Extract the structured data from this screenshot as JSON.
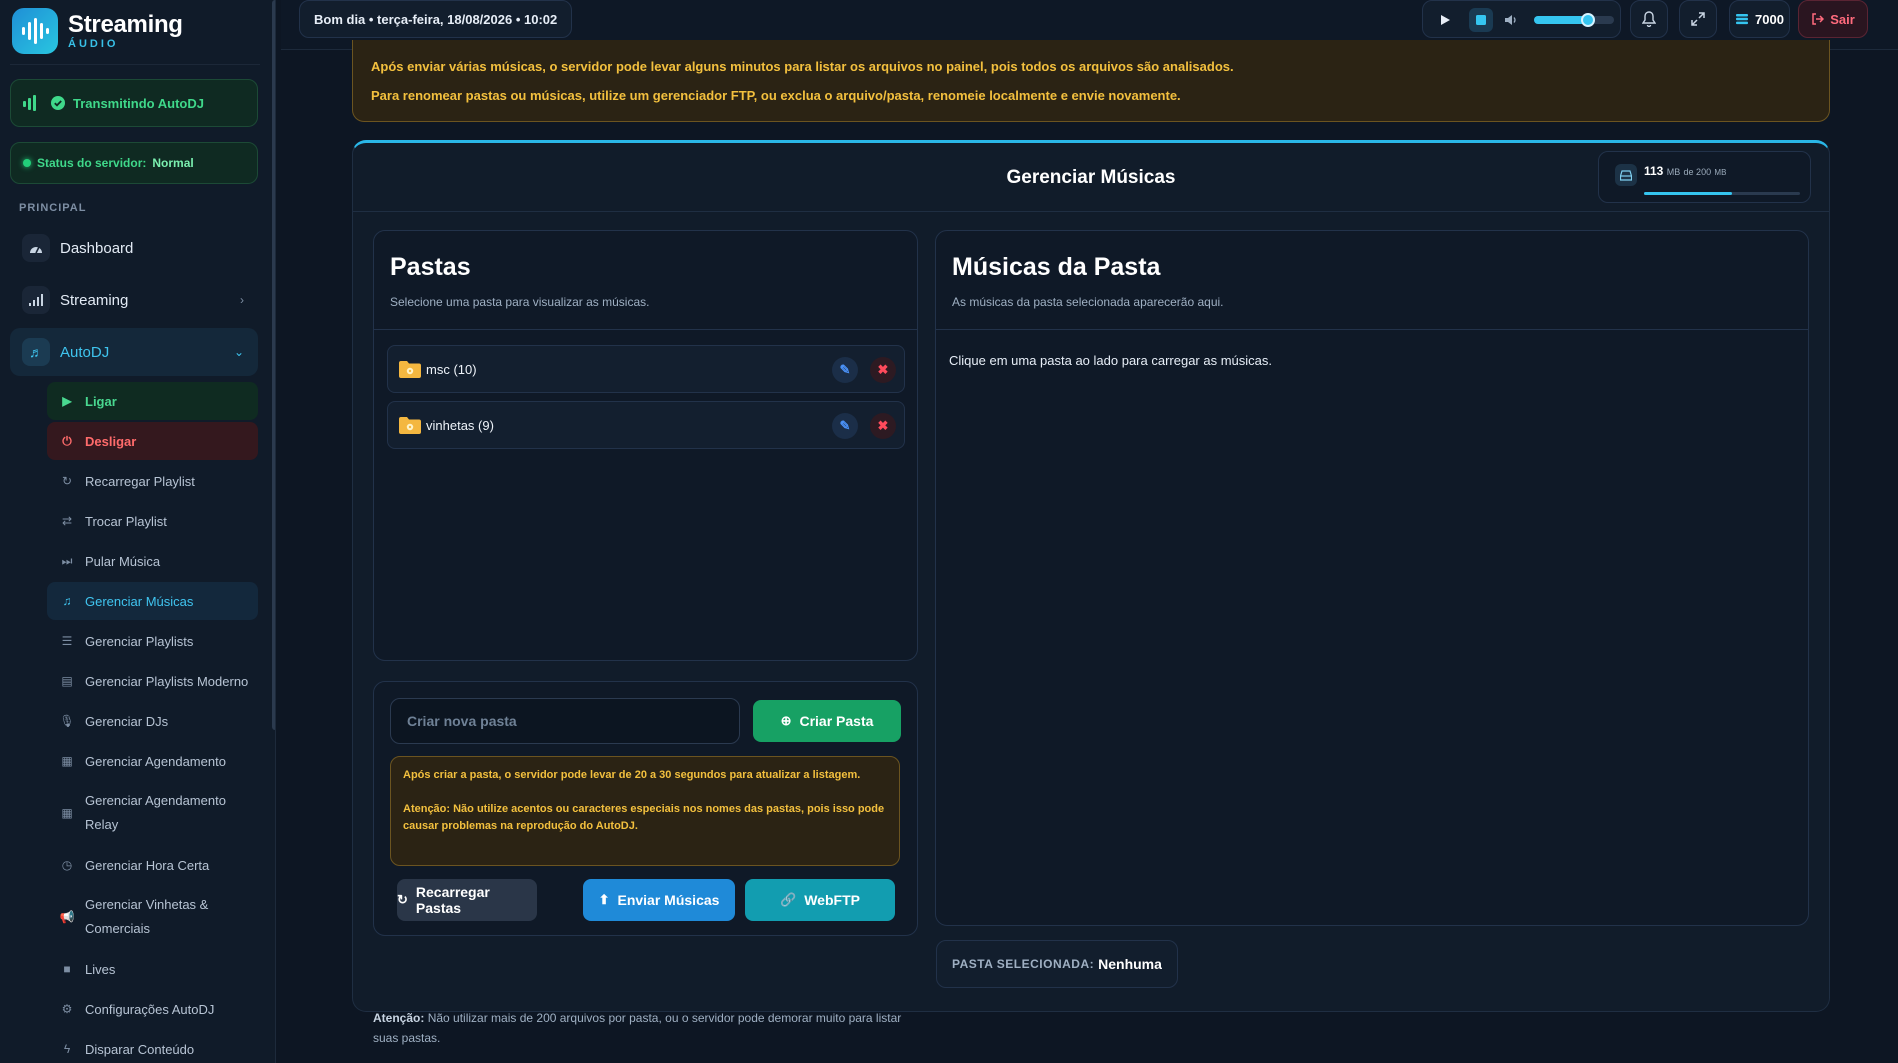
{
  "brand": {
    "title": "Streaming",
    "subtitle": "ÁUDIO"
  },
  "status": {
    "live": "Transmitindo AutoDJ",
    "server_label": "Status do servidor:",
    "server_value": "Normal"
  },
  "sidebar": {
    "section": "PRINCIPAL",
    "top": [
      {
        "label": "Dashboard",
        "icon": "gauge-icon"
      },
      {
        "label": "Streaming",
        "icon": "signal-icon"
      },
      {
        "label": "AutoDJ",
        "icon": "music-icon"
      }
    ],
    "sub": [
      {
        "label": "Ligar",
        "icon": "play-circle-icon"
      },
      {
        "label": "Desligar",
        "icon": "power-icon"
      },
      {
        "label": "Recarregar Playlist",
        "icon": "refresh-icon"
      },
      {
        "label": "Trocar Playlist",
        "icon": "swap-icon"
      },
      {
        "label": "Pular Música",
        "icon": "skip-icon"
      },
      {
        "label": "Gerenciar Músicas",
        "icon": "music-icon"
      },
      {
        "label": "Gerenciar Playlists",
        "icon": "list-icon"
      },
      {
        "label": "Gerenciar Playlists Moderno",
        "icon": "table-icon"
      },
      {
        "label": "Gerenciar DJs",
        "icon": "microphone-icon"
      },
      {
        "label": "Gerenciar Agendamento",
        "icon": "calendar-icon"
      },
      {
        "label": "Gerenciar Agendamento Relay",
        "icon": "calendar-icon"
      },
      {
        "label": "Gerenciar Hora Certa",
        "icon": "clock-icon"
      },
      {
        "label": "Gerenciar Vinhetas & Comerciais",
        "icon": "megaphone-icon"
      },
      {
        "label": "Lives",
        "icon": "video-icon"
      },
      {
        "label": "Configurações AutoDJ",
        "icon": "gear-icon"
      },
      {
        "label": "Disparar Conteúdo",
        "icon": "bolt-icon"
      }
    ]
  },
  "topbar": {
    "greeting": "Bom dia • terça-feira, 18/08/2026 • 10:02",
    "volume": 0.68,
    "credits": "7000",
    "logout": "Sair"
  },
  "alert": {
    "line1": "Após enviar várias músicas, o servidor pode levar alguns minutos para listar os arquivos no painel, pois todos os arquivos são analisados.",
    "line2": "Para renomear pastas ou músicas, utilize um gerenciador FTP, ou exclua o arquivo/pasta, renomeie localmente e envie novamente."
  },
  "panel": {
    "title": "Gerenciar Músicas",
    "storage": {
      "used": "113",
      "unit": "MB",
      "of": "de 200",
      "unit2": "MB",
      "fraction": 0.565
    }
  },
  "folders": {
    "title": "Pastas",
    "subtitle": "Selecione uma pasta para visualizar as músicas.",
    "items": [
      {
        "label": "msc (10)"
      },
      {
        "label": "vinhetas (9)"
      }
    ],
    "new_placeholder": "Criar nova pasta",
    "create_button": "Criar Pasta",
    "warn1": "Após criar a pasta, o servidor pode levar de 20 a 30 segundos para atualizar a listagem.",
    "warn2": "Atenção: Não utilize acentos ou caracteres especiais nos nomes das pastas, pois isso pode causar problemas na reprodução do AutoDJ.",
    "reload_button": "Recarregar Pastas",
    "upload_button": "Enviar Músicas",
    "webftp_button": "WebFTP",
    "note_bold": "Atenção:",
    "note_text": "Não utilizar mais de 200 arquivos por pasta, ou o servidor pode demorar muito para listar suas pastas."
  },
  "songs": {
    "title": "Músicas da Pasta",
    "subtitle": "As músicas da pasta selecionada aparecerão aqui.",
    "empty": "Clique em uma pasta ao lado para carregar as músicas.",
    "selected_label": "PASTA SELECIONADA:",
    "selected_value": "Nenhuma"
  },
  "colors": {
    "accent": "#2ab7e8",
    "success": "#22d07a",
    "danger": "#ff4b5c",
    "warning": "#f3c03e"
  }
}
